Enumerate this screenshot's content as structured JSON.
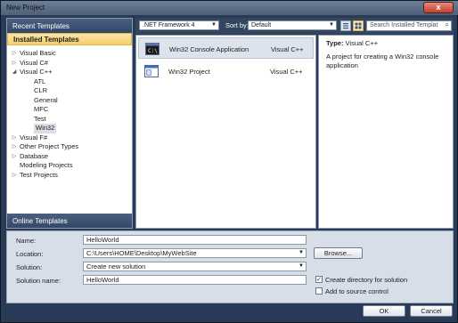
{
  "window": {
    "title": "New Project",
    "close_glyph": "x"
  },
  "left_panel": {
    "recent_header": "Recent Templates",
    "installed_header": "Installed Templates",
    "tree": [
      {
        "label": "Visual Basic",
        "indent": 0,
        "arrow": "right"
      },
      {
        "label": "Visual C#",
        "indent": 0,
        "arrow": "right"
      },
      {
        "label": "Visual C++",
        "indent": 0,
        "arrow": "down"
      },
      {
        "label": "ATL",
        "indent": 1,
        "arrow": ""
      },
      {
        "label": "CLR",
        "indent": 1,
        "arrow": ""
      },
      {
        "label": "General",
        "indent": 1,
        "arrow": ""
      },
      {
        "label": "MFC",
        "indent": 1,
        "arrow": ""
      },
      {
        "label": "Test",
        "indent": 1,
        "arrow": ""
      },
      {
        "label": "Win32",
        "indent": 1,
        "arrow": "",
        "selected": true
      },
      {
        "label": "Visual F#",
        "indent": 0,
        "arrow": "right"
      },
      {
        "label": "Other Project Types",
        "indent": 0,
        "arrow": "right"
      },
      {
        "label": "Database",
        "indent": 0,
        "arrow": "right"
      },
      {
        "label": "Modeling Projects",
        "indent": 0,
        "arrow": ""
      },
      {
        "label": "Test Projects",
        "indent": 0,
        "arrow": "right"
      }
    ],
    "online_header": "Online Templates"
  },
  "toolbar": {
    "framework": ".NET Framework 4",
    "sort_label": "Sort by:",
    "sort_value": "Default",
    "search_placeholder": "Search Installed Templat",
    "search_icon": "magnifier-icon"
  },
  "templates": [
    {
      "name": "Win32 Console Application",
      "lang": "Visual C++",
      "icon": "console-app-icon",
      "selected": true
    },
    {
      "name": "Win32 Project",
      "lang": "Visual C++",
      "icon": "win32-project-icon",
      "selected": false
    }
  ],
  "description": {
    "type_label": "Type:",
    "type_value": "Visual C++",
    "text": "A project for creating a Win32 console application"
  },
  "form": {
    "name_label": "Name:",
    "name_value": "HelloWorld",
    "location_label": "Location:",
    "location_value": "C:\\Users\\HOME\\Desktop\\MyWebSite",
    "browse_label": "Browse...",
    "solution_label": "Solution:",
    "solution_value": "Create new solution",
    "solution_name_label": "Solution name:",
    "solution_name_value": "HelloWorld",
    "create_dir_label": "Create directory for solution",
    "create_dir_checked": true,
    "source_control_label": "Add to source control",
    "source_control_checked": false,
    "ok_label": "OK",
    "cancel_label": "Cancel"
  }
}
